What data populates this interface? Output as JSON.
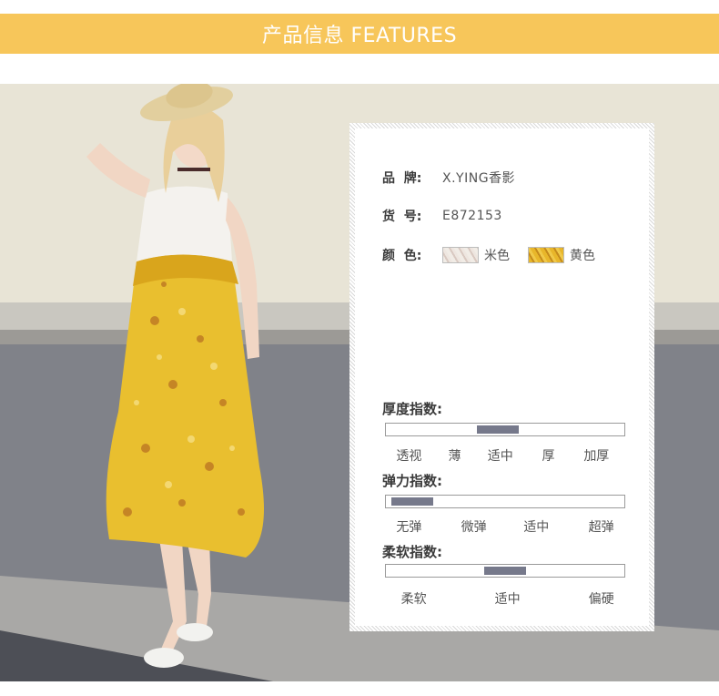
{
  "banner": {
    "title": "产品信息 FEATURES"
  },
  "colors": {
    "banner": "#f7c65a",
    "scale_fill": "#76798b",
    "dress": "#e9bf2f"
  },
  "product": {
    "brand_label": "品  牌:",
    "brand_value": "X.YING香影",
    "sku_label": "货  号:",
    "sku_value": "E872153",
    "color_label": "颜  色:",
    "color_options": [
      "米色",
      "黄色"
    ]
  },
  "scales": [
    {
      "title": "厚度指数:",
      "labels": [
        "透视",
        "薄",
        "适中",
        "厚",
        "加厚"
      ],
      "level_fraction": 0.47
    },
    {
      "title": "弹力指数:",
      "labels": [
        "无弹",
        "微弹",
        "适中",
        "超弹"
      ],
      "level_fraction": 0.11
    },
    {
      "title": "柔软指数:",
      "labels": [
        "柔软",
        "适中",
        "偏硬"
      ],
      "level_fraction": 0.5
    }
  ]
}
